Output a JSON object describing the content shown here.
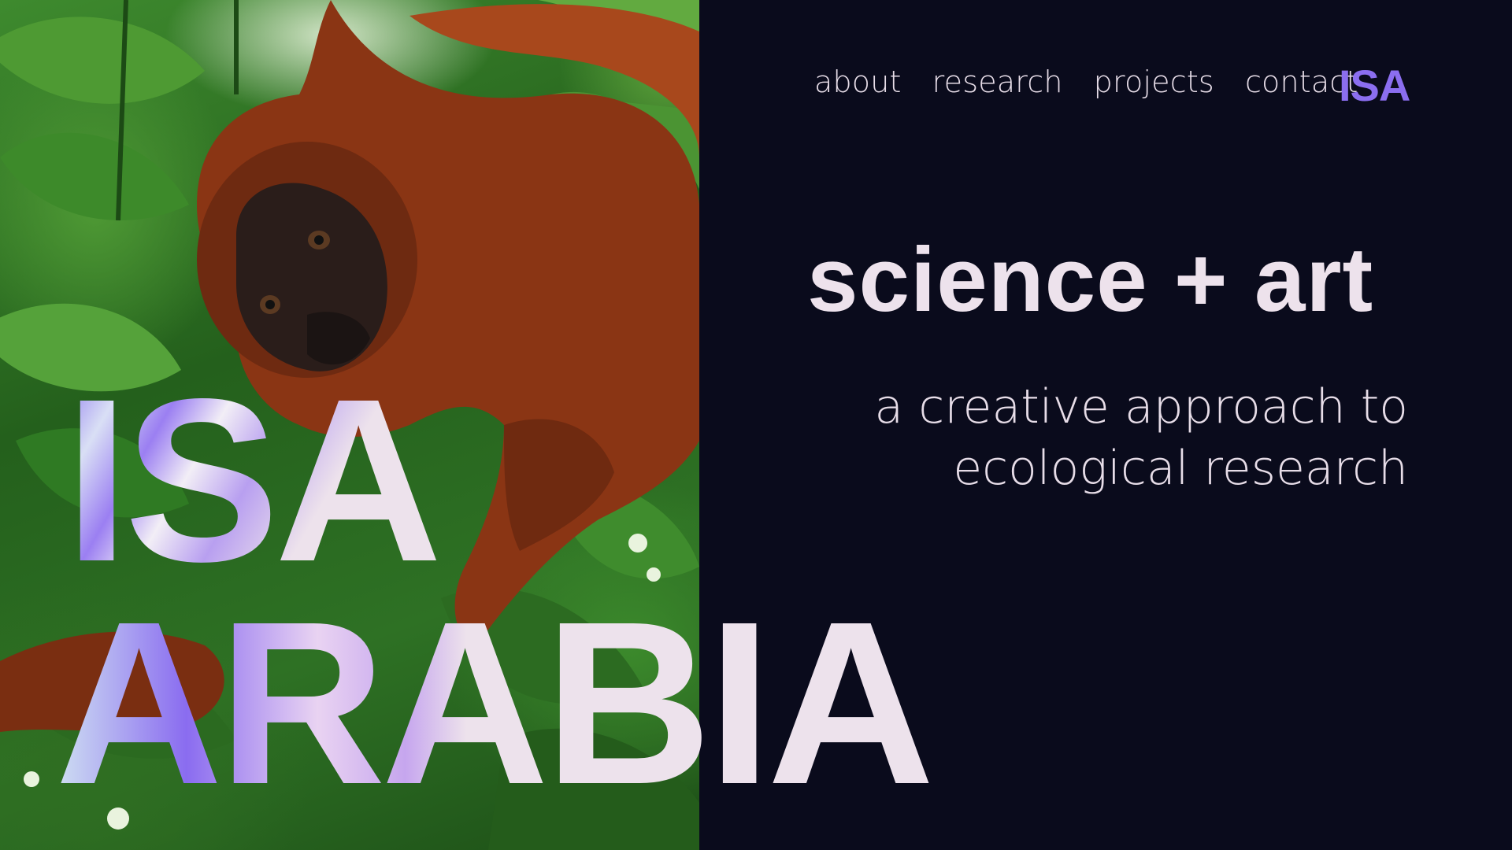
{
  "nav": {
    "items": [
      {
        "label": "about"
      },
      {
        "label": "research"
      },
      {
        "label": "projects"
      },
      {
        "label": "contact"
      }
    ],
    "logo": "ISA"
  },
  "hero": {
    "title": "science + art",
    "subtitle_line1": "a creative approach to",
    "subtitle_line2": "ecological research"
  },
  "name": {
    "first": "ISA",
    "last": "ARABIA"
  },
  "colors": {
    "background": "#0a0b1c",
    "accent": "#8b6ef0",
    "text": "#ede2ec"
  }
}
